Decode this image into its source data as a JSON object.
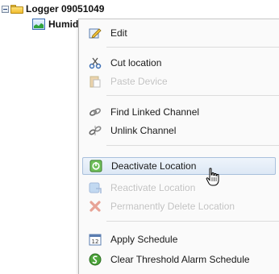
{
  "tree": {
    "root_label": "Logger 09051049",
    "child_label": "Humidity"
  },
  "menu": {
    "items": [
      {
        "label": "Edit",
        "icon": "edit-icon",
        "enabled": true
      },
      {
        "label": "Cut location",
        "icon": "scissors-icon",
        "enabled": true
      },
      {
        "label": "Paste Device",
        "icon": "paste-icon",
        "enabled": false
      },
      {
        "label": "Find Linked Channel",
        "icon": "chain-link-icon",
        "enabled": true
      },
      {
        "label": "Unlink Channel",
        "icon": "broken-link-icon",
        "enabled": true
      },
      {
        "label": "Deactivate Location",
        "icon": "deactivate-icon",
        "enabled": true,
        "hovered": true
      },
      {
        "label": "Reactivate Location",
        "icon": "reactivate-icon",
        "enabled": false
      },
      {
        "label": "Permanently Delete Location",
        "icon": "delete-x-icon",
        "enabled": false
      },
      {
        "label": "Apply Schedule",
        "icon": "calendar-icon",
        "enabled": true
      },
      {
        "label": "Clear Threshold Alarm Schedule",
        "icon": "clear-schedule-icon",
        "enabled": true
      }
    ]
  },
  "colors": {
    "hover_background": "#dde8f5",
    "hover_border": "#a9c0dc",
    "disabled_text": "#c2c2c2"
  }
}
